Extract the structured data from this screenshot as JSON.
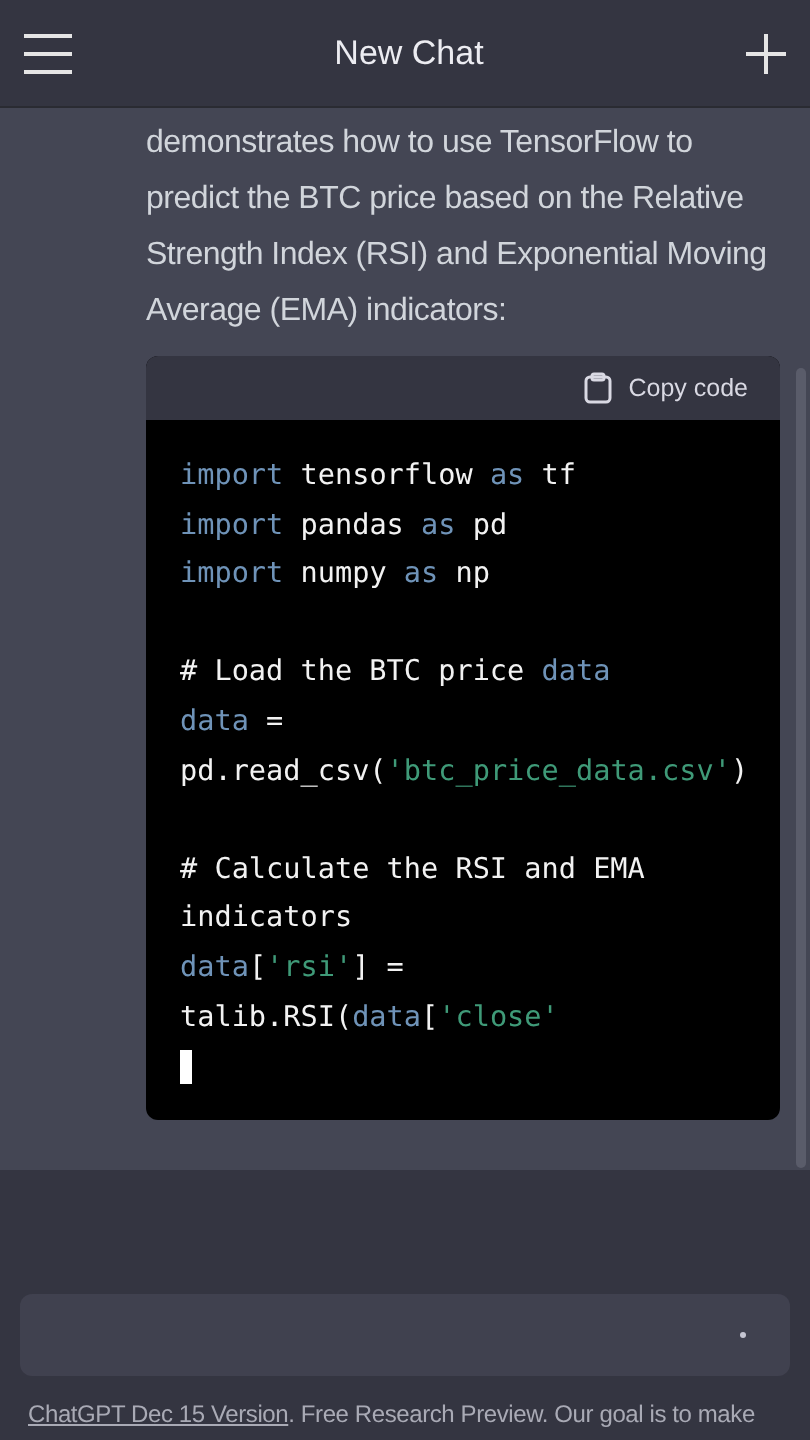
{
  "header": {
    "title": "New Chat"
  },
  "message": {
    "paragraph": "demonstrates how to use TensorFlow to predict the BTC price based on the Relative Strength Index (RSI) and Exponential Moving Average (EMA) indicators:"
  },
  "code_block": {
    "copy_label": "Copy code",
    "cursor": true,
    "lines": [
      [
        {
          "text": "import",
          "kind": "keyword"
        },
        {
          "text": " tensorflow ",
          "kind": "plain"
        },
        {
          "text": "as",
          "kind": "keyword"
        },
        {
          "text": " tf",
          "kind": "plain"
        }
      ],
      [
        {
          "text": "import",
          "kind": "keyword"
        },
        {
          "text": " pandas ",
          "kind": "plain"
        },
        {
          "text": "as",
          "kind": "keyword"
        },
        {
          "text": " pd",
          "kind": "plain"
        }
      ],
      [
        {
          "text": "import",
          "kind": "keyword"
        },
        {
          "text": " numpy ",
          "kind": "plain"
        },
        {
          "text": "as",
          "kind": "keyword"
        },
        {
          "text": " np",
          "kind": "plain"
        }
      ],
      {
        "kind": "blank"
      },
      [
        {
          "text": "# Load the BTC price ",
          "kind": "plain"
        },
        {
          "text": "data",
          "kind": "keyword"
        }
      ],
      [
        {
          "text": "data",
          "kind": "keyword"
        },
        {
          "text": " =",
          "kind": "plain"
        }
      ],
      [
        {
          "text": "pd.read_csv(",
          "kind": "plain"
        },
        {
          "text": "'btc_price_data.csv'",
          "kind": "string"
        },
        {
          "text": ")",
          "kind": "plain"
        }
      ],
      {
        "kind": "blank"
      },
      [
        {
          "text": "# Calculate the RSI and EMA",
          "kind": "plain"
        }
      ],
      [
        {
          "text": "indicators",
          "kind": "plain"
        }
      ],
      [
        {
          "text": "data",
          "kind": "keyword"
        },
        {
          "text": "[",
          "kind": "plain"
        },
        {
          "text": "'rsi'",
          "kind": "string"
        },
        {
          "text": "] =",
          "kind": "plain"
        }
      ],
      [
        {
          "text": "talib.RSI(",
          "kind": "plain"
        },
        {
          "text": "data",
          "kind": "keyword"
        },
        {
          "text": "[",
          "kind": "plain"
        },
        {
          "text": "'close'",
          "kind": "string"
        }
      ]
    ]
  },
  "footer": {
    "link": "ChatGPT Dec 15 Version",
    "text": ". Free Research Preview. Our goal is to make"
  }
}
